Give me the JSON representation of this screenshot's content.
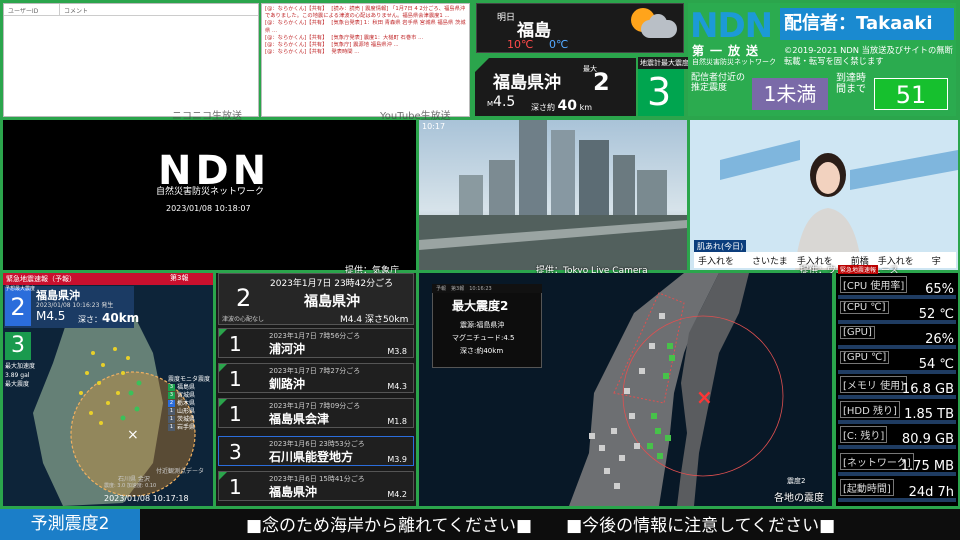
{
  "comment_panel": {
    "col_user": "ユーザーID",
    "col_comment": "コメント",
    "label": "ニコニコ生放送"
  },
  "chat": {
    "lines": [
      {
        "who": "[@：ならかくん]【共有】",
        "text": "[読み：読売 | 震度情報] 「1月7日 4 2分ごろ、福島県沖でありました。この地震による津波の心配はありません。福島県会津震度1 ..."
      },
      {
        "who": "[@：ならかくん]【共有】",
        "text": "[気象台発表] 1：秋田 青森県 岩手県 宮城県 福島県 茨城県 ..."
      },
      {
        "who": "[@：ならかくん]【共有】",
        "text": "[気象庁発表] 震度1：大槌町 石巻市 ..."
      },
      {
        "who": "[@：ならかくん]【共有】",
        "text": "[気象庁] 震源地 福島県沖 ..."
      },
      {
        "who": "[@：ならかくん]【共有】",
        "text": "発表時間 ..."
      }
    ],
    "label": "YouTube生放送"
  },
  "weather": {
    "day": "明日",
    "city": "福島",
    "max": "10℃",
    "min": "0℃",
    "icon": "sun-cloud-icon"
  },
  "quake_summary": {
    "place": "福島県沖",
    "max_label": "最大",
    "max_int": "2",
    "mag_prefix": "M",
    "mag": "4.5",
    "depth_label": "深さ約",
    "depth": "40",
    "depth_unit": "km"
  },
  "seismometer": {
    "label": "地震計最大震度",
    "value": "3"
  },
  "header": {
    "logo": "NDN",
    "sender": "配信者：Takaaki",
    "sub1": "第一放送",
    "sub2": "自然災害防災ネットワーク",
    "copyright": "©2019-2021 NDN 当放送及びサイトの無断転載・転写を固く禁じます",
    "arrive_label": "配信者付近の推定震度",
    "arrive_int": "1未満",
    "arrive_time_label": "到達時間まで",
    "arrive_time": "51"
  },
  "logo_panel": {
    "logo": "NDN",
    "sub": "自然災害防災ネットワーク",
    "time": "2023/01/08 10:18:07"
  },
  "camera": {
    "credit": "提供：Tokyo Live Camera",
    "credit_left": "提供：気象庁",
    "time": "10:17"
  },
  "news": {
    "caption": "肌あれ(今日)",
    "ticker": "手入れを　　さいたま　手入れを　　前橋　手入れを　　宇",
    "credit": "提供：ウェザーニュース"
  },
  "eew": {
    "header": "緊急地震速報（予報）",
    "count": "第3報",
    "pred_label": "予想最大震度",
    "pred_int": "2",
    "place": "福島県沖",
    "time": "2023/01/08 10:16:23 発生",
    "mag": "M4.5",
    "depth_label": "深さ：",
    "depth": "40km",
    "obs_int": "3",
    "accel_l1": "最大加速度",
    "accel_l2": "3.89 gal",
    "accel_l3": "最大震度",
    "legend_title": "震度モニタ震度",
    "legend": [
      {
        "int": "3",
        "name": "福島県",
        "color": "#1aa04e"
      },
      {
        "int": "3",
        "name": "宮城県",
        "color": "#1aa04e"
      },
      {
        "int": "2",
        "name": "栃木県",
        "color": "#2b6ddb"
      },
      {
        "int": "1",
        "name": "山形県",
        "color": "#4f5b6b"
      },
      {
        "int": "1",
        "name": "茨城県",
        "color": "#4f5b6b"
      },
      {
        "int": "1",
        "name": "岩手県",
        "color": "#4f5b6b"
      }
    ],
    "obs_near": "付近観測点データ",
    "obs_near2": "石川県 金沢",
    "obs_near3": "震度: 3.0 加速度: 0.10",
    "footer": "2023/01/08 10:17:18"
  },
  "quake_list": {
    "top": {
      "date": "2023年1月7日 23時42分ごろ",
      "int": "2",
      "place": "福島県沖",
      "tsunami": "津波の心配なし",
      "mag": "M4.4 深さ50km"
    },
    "items": [
      {
        "date": "2023年1月7日 7時56分ごろ",
        "int": "1",
        "place": "浦河沖",
        "mag": "M3.8"
      },
      {
        "date": "2023年1月7日 7時27分ごろ",
        "int": "1",
        "place": "釧路沖",
        "mag": "M4.3"
      },
      {
        "date": "2023年1月7日 7時09分ごろ",
        "int": "1",
        "place": "福島県会津",
        "mag": "M1.8"
      },
      {
        "date": "2023年1月6日 23時53分ごろ",
        "int": "3",
        "place": "石川県能登地方",
        "mag": "M3.9"
      },
      {
        "date": "2023年1月6日 15時41分ごろ",
        "int": "1",
        "place": "福島県沖",
        "mag": "M4.2"
      }
    ]
  },
  "center_map": {
    "card_head_left": "予報",
    "card_head_mid": "第3報",
    "card_head_time": "10:16:23",
    "title": "最大震度2",
    "l1": "震源:福島県沖",
    "l2": "マグニチュード:4.5",
    "l3": "深さ:約40km",
    "legend": "震度2",
    "footer": "各地の震度"
  },
  "stats": {
    "header": "緊急地震速報",
    "rows": [
      {
        "k": "[CPU 使用率]",
        "v": "65%"
      },
      {
        "k": "[CPU ℃]",
        "v": "52 ℃"
      },
      {
        "k": "[GPU]",
        "v": "26%"
      },
      {
        "k": "[GPU ℃]",
        "v": "54 ℃"
      },
      {
        "k": "[メモリ 使用]",
        "v": "16.8 GB"
      },
      {
        "k": "[HDD 残り]",
        "v": "1.85 TB"
      },
      {
        "k": "[C: 残り]",
        "v": "80.9 GB"
      },
      {
        "k": "[ネットワーク]",
        "v": "1.75 MB"
      },
      {
        "k": "[起動時間]",
        "v": "24d 7h"
      }
    ]
  },
  "bottom": {
    "label": "予測震度2",
    "text": "■念のため海岸から離れてください■　　■今後の情報に注意してください■"
  }
}
